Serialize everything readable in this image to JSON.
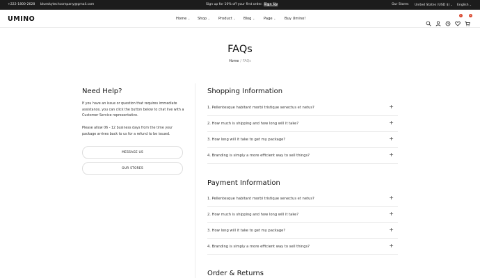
{
  "topbar": {
    "phone": "+222-1800-2628",
    "email": "blueskytechcompany@gmail.com",
    "promo_text": "Sign up for 10% off your first order.",
    "promo_link": "Sign Up",
    "stores": "Our Stores",
    "currency": "United States (USD $)",
    "language": "English"
  },
  "header": {
    "logo": "UMINO",
    "nav": [
      "Home",
      "Shop",
      "Product",
      "Blog",
      "Page",
      "Buy Umino!"
    ],
    "wishlist_count": "1",
    "cart_count": "0",
    "icons": [
      "search-icon",
      "account-icon",
      "history-icon",
      "wishlist-icon",
      "cart-icon"
    ]
  },
  "page": {
    "title": "FAQs",
    "breadcrumb_home": "Home",
    "breadcrumb_sep": "/",
    "breadcrumb_current": "FAQs"
  },
  "sidebar": {
    "title": "Need Help?",
    "paragraph1": "If you have an issue or question that requires immediate assistance, you can click the button below to chat live with a Customer Service representative.",
    "paragraph2": "Please allow 06 - 12 business days from the time your package arrives back to us for a refund to be issued.",
    "button_message": "MESSAGE US",
    "button_stores": "OUR STORES"
  },
  "sections": [
    {
      "title": "Shopping Information",
      "questions": [
        "1. Pellentesque habitant morbi tristique senectus et netus?",
        "2. How much is shipping and how long will it take?",
        "3. How long will it take to get my package?",
        "4. Branding is simply a more efficient way to sell things?"
      ]
    },
    {
      "title": "Payment Information",
      "questions": [
        "1. Pellentesque habitant morbi tristique senectus et netus?",
        "2. How much is shipping and how long will it take?",
        "3. How long will it take to get my package?",
        "4. Branding is simply a more efficient way to sell things?"
      ]
    },
    {
      "title": "Order & Returns",
      "questions": []
    }
  ],
  "colors": {
    "topbar_bg": "#1c1c1c",
    "badge": "#d9462c",
    "divider": "#ececec"
  }
}
